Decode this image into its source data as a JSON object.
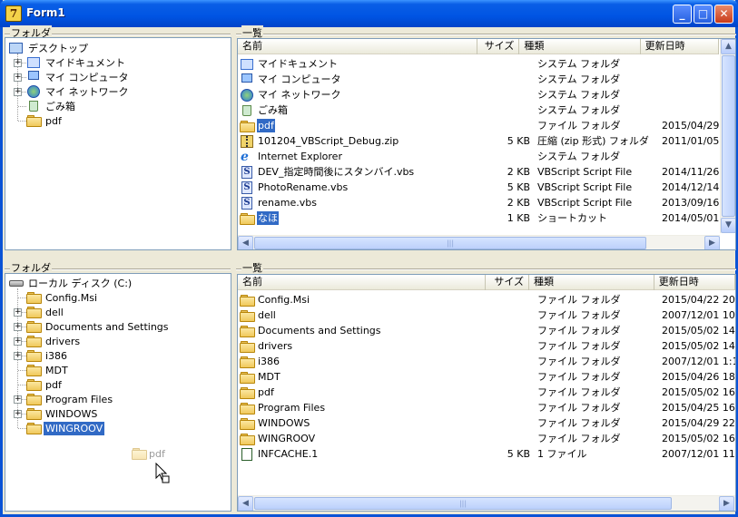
{
  "window": {
    "title": "Form1"
  },
  "top": {
    "folder_label": "フォルダ",
    "list_label": "一覧",
    "tree": [
      {
        "label": "デスクトップ",
        "icon": "desktop-icon",
        "expander": ""
      },
      {
        "label": "マイドキュメント",
        "icon": "my-documents-icon",
        "expander": "+"
      },
      {
        "label": "マイ コンピュータ",
        "icon": "my-computer-icon",
        "expander": "+"
      },
      {
        "label": "マイ ネットワーク",
        "icon": "my-network-icon",
        "expander": "+"
      },
      {
        "label": "ごみ箱",
        "icon": "recycle-bin-icon",
        "expander": ""
      },
      {
        "label": "pdf",
        "icon": "folder-icon",
        "expander": ""
      }
    ],
    "columns": [
      "名前",
      "サイズ",
      "種類",
      "更新日時"
    ],
    "rows": [
      {
        "name": "マイドキュメント",
        "size": "",
        "type": "システム フォルダ",
        "date": "",
        "icon": "my-documents-icon",
        "selected": false
      },
      {
        "name": "マイ コンピュータ",
        "size": "",
        "type": "システム フォルダ",
        "date": "",
        "icon": "my-computer-icon",
        "selected": false
      },
      {
        "name": "マイ ネットワーク",
        "size": "",
        "type": "システム フォルダ",
        "date": "",
        "icon": "my-network-icon",
        "selected": false
      },
      {
        "name": "ごみ箱",
        "size": "",
        "type": "システム フォルダ",
        "date": "",
        "icon": "recycle-bin-icon",
        "selected": false
      },
      {
        "name": "pdf",
        "size": "",
        "type": "ファイル フォルダ",
        "date": "2015/04/29",
        "icon": "folder-icon",
        "selected": true
      },
      {
        "name": "101204_VBScript_Debug.zip",
        "size": "5 KB",
        "type": "圧縮 (zip 形式) フォルダ",
        "date": "2011/01/05",
        "icon": "zip-icon",
        "selected": false
      },
      {
        "name": "Internet Explorer",
        "size": "",
        "type": "システム フォルダ",
        "date": "",
        "icon": "internet-explorer-icon",
        "selected": false
      },
      {
        "name": "DEV_指定時間後にスタンバイ.vbs",
        "size": "2 KB",
        "type": "VBScript Script File",
        "date": "2014/11/26",
        "icon": "vbscript-icon",
        "selected": false
      },
      {
        "name": "PhotoRename.vbs",
        "size": "5 KB",
        "type": "VBScript Script File",
        "date": "2014/12/14",
        "icon": "vbscript-icon",
        "selected": false
      },
      {
        "name": "rename.vbs",
        "size": "2 KB",
        "type": "VBScript Script File",
        "date": "2013/09/16",
        "icon": "vbscript-icon",
        "selected": false
      },
      {
        "name": "なほ",
        "size": "1 KB",
        "type": "ショートカット",
        "date": "2014/05/01",
        "icon": "shortcut-folder-icon",
        "selected": true
      }
    ]
  },
  "bottom": {
    "folder_label": "フォルダ",
    "list_label": "一覧",
    "tree": [
      {
        "label": "ローカル ディスク (C:)",
        "icon": "drive-icon",
        "expander": ""
      },
      {
        "label": "Config.Msi",
        "icon": "folder-icon",
        "expander": ""
      },
      {
        "label": "dell",
        "icon": "folder-icon",
        "expander": "+"
      },
      {
        "label": "Documents and Settings",
        "icon": "folder-icon",
        "expander": "+"
      },
      {
        "label": "drivers",
        "icon": "folder-icon",
        "expander": "+"
      },
      {
        "label": "i386",
        "icon": "folder-icon",
        "expander": "+"
      },
      {
        "label": "MDT",
        "icon": "folder-icon",
        "expander": ""
      },
      {
        "label": "pdf",
        "icon": "folder-icon",
        "expander": ""
      },
      {
        "label": "Program Files",
        "icon": "folder-icon",
        "expander": "+"
      },
      {
        "label": "WINDOWS",
        "icon": "folder-icon",
        "expander": "+"
      },
      {
        "label": "WINGROOV",
        "icon": "folder-icon",
        "expander": "",
        "selected": true
      }
    ],
    "drag_ghost": "pdf",
    "columns": [
      "名前",
      "サイズ",
      "種類",
      "更新日時"
    ],
    "rows": [
      {
        "name": "Config.Msi",
        "size": "",
        "type": "ファイル フォルダ",
        "date": "2015/04/22 20",
        "icon": "folder-icon"
      },
      {
        "name": "dell",
        "size": "",
        "type": "ファイル フォルダ",
        "date": "2007/12/01 10",
        "icon": "folder-icon"
      },
      {
        "name": "Documents and Settings",
        "size": "",
        "type": "ファイル フォルダ",
        "date": "2015/05/02 14",
        "icon": "folder-icon"
      },
      {
        "name": "drivers",
        "size": "",
        "type": "ファイル フォルダ",
        "date": "2015/05/02 14",
        "icon": "folder-icon"
      },
      {
        "name": "i386",
        "size": "",
        "type": "ファイル フォルダ",
        "date": "2007/12/01 1:1",
        "icon": "folder-icon"
      },
      {
        "name": "MDT",
        "size": "",
        "type": "ファイル フォルダ",
        "date": "2015/04/26 18",
        "icon": "folder-icon"
      },
      {
        "name": "pdf",
        "size": "",
        "type": "ファイル フォルダ",
        "date": "2015/05/02 16",
        "icon": "folder-icon"
      },
      {
        "name": "Program Files",
        "size": "",
        "type": "ファイル フォルダ",
        "date": "2015/04/25 16",
        "icon": "folder-icon"
      },
      {
        "name": "WINDOWS",
        "size": "",
        "type": "ファイル フォルダ",
        "date": "2015/04/29 22",
        "icon": "folder-icon"
      },
      {
        "name": "WINGROOV",
        "size": "",
        "type": "ファイル フォルダ",
        "date": "2015/05/02 16",
        "icon": "folder-icon"
      },
      {
        "name": "INFCACHE.1",
        "size": "5 KB",
        "type": "1 ファイル",
        "date": "2007/12/01 11",
        "icon": "file-icon"
      }
    ]
  },
  "colors": {
    "selection": "#316ac5",
    "titlebar": "#0054e3",
    "face": "#ece9d8"
  }
}
